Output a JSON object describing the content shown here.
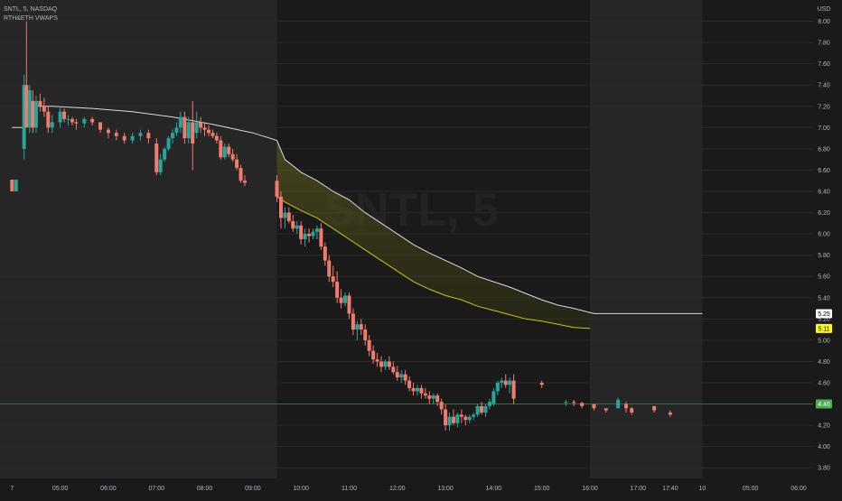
{
  "legend": {
    "symbol_line": "SNTL, 5, NASDAQ",
    "indicator_line": "RTH&ETH VWAPS"
  },
  "watermark": "SNTL, 5",
  "colors": {
    "background": "#1a1a1a",
    "extended_session_bg": "#262626",
    "up_candle": "#26a69a",
    "down_candle": "#ef7c6e",
    "eth_vwap": "#d9d9d9",
    "rth_vwap": "#c8c800",
    "current_price": "#4caf50",
    "rth_vwap_badge": "#ffff00"
  },
  "chart_data": {
    "type": "candlestick",
    "currency_label": "USD",
    "ylim": [
      3.7,
      8.2
    ],
    "y_ticks": [
      "8.00",
      "7.80",
      "7.60",
      "7.40",
      "7.20",
      "7.00",
      "6.80",
      "6.60",
      "6.40",
      "6.20",
      "6.00",
      "5.80",
      "5.60",
      "5.40",
      "5.20",
      "5.00",
      "4.80",
      "4.60",
      "4.40",
      "4.20",
      "4.00",
      "3.80"
    ],
    "x_ticks": [
      {
        "label": "7",
        "t": 0
      },
      {
        "label": "05:00",
        "t": 60
      },
      {
        "label": "06:00",
        "t": 120
      },
      {
        "label": "07:00",
        "t": 180
      },
      {
        "label": "08:00",
        "t": 240
      },
      {
        "label": "09:00",
        "t": 300
      },
      {
        "label": "10:00",
        "t": 360
      },
      {
        "label": "11:00",
        "t": 420
      },
      {
        "label": "12:00",
        "t": 480
      },
      {
        "label": "13:00",
        "t": 540
      },
      {
        "label": "14:00",
        "t": 600
      },
      {
        "label": "15:00",
        "t": 660
      },
      {
        "label": "16:00",
        "t": 720
      },
      {
        "label": "17:00",
        "t": 780
      },
      {
        "label": "17:40",
        "t": 820
      },
      {
        "label": "10",
        "t": 860
      },
      {
        "label": "05:00",
        "t": 920
      },
      {
        "label": "06:00",
        "t": 980
      }
    ],
    "regular_session": {
      "start": 330,
      "end": 720
    },
    "price_badges": [
      {
        "name": "eth_vwap",
        "value": "5.25"
      },
      {
        "name": "rth_vwap",
        "value": "5.11"
      },
      {
        "name": "last_price",
        "value": "4.40"
      }
    ],
    "candles": [
      [
        0,
        6.51,
        6.51,
        6.4,
        6.4
      ],
      [
        5,
        6.4,
        6.51,
        6.4,
        6.51
      ],
      [
        15,
        6.8,
        7.5,
        6.7,
        7.4
      ],
      [
        18,
        7.4,
        8.0,
        7.3,
        7.0
      ],
      [
        22,
        7.0,
        7.4,
        6.95,
        7.35
      ],
      [
        26,
        7.25,
        7.35,
        6.95,
        7.0
      ],
      [
        30,
        7.0,
        7.3,
        6.95,
        7.25
      ],
      [
        35,
        7.25,
        7.32,
        7.15,
        7.2
      ],
      [
        40,
        7.2,
        7.28,
        7.1,
        7.15
      ],
      [
        45,
        7.15,
        7.2,
        6.95,
        7.0
      ],
      [
        50,
        7.0,
        7.12,
        6.95,
        7.05
      ],
      [
        60,
        7.05,
        7.2,
        7.0,
        7.15
      ],
      [
        65,
        7.15,
        7.18,
        7.05,
        7.08
      ],
      [
        70,
        7.08,
        7.12,
        7.02,
        7.08
      ],
      [
        75,
        7.08,
        7.1,
        7.02,
        7.05
      ],
      [
        80,
        7.05,
        7.08,
        6.98,
        7.04
      ],
      [
        90,
        7.04,
        7.1,
        7.0,
        7.08
      ],
      [
        100,
        7.08,
        7.1,
        7.02,
        7.05
      ],
      [
        110,
        7.05,
        7.05,
        6.95,
        6.98
      ],
      [
        120,
        6.98,
        7.0,
        6.9,
        6.95
      ],
      [
        130,
        6.95,
        6.98,
        6.88,
        6.92
      ],
      [
        140,
        6.92,
        6.95,
        6.85,
        6.88
      ],
      [
        150,
        6.88,
        6.95,
        6.85,
        6.92
      ],
      [
        160,
        6.92,
        6.98,
        6.88,
        6.95
      ],
      [
        170,
        6.95,
        6.98,
        6.85,
        6.9
      ],
      [
        180,
        6.85,
        6.9,
        6.55,
        6.58
      ],
      [
        185,
        6.58,
        6.75,
        6.55,
        6.7
      ],
      [
        190,
        6.7,
        6.82,
        6.68,
        6.8
      ],
      [
        195,
        6.8,
        6.92,
        6.78,
        6.9
      ],
      [
        200,
        6.9,
        6.98,
        6.85,
        6.95
      ],
      [
        205,
        6.95,
        7.05,
        6.92,
        7.0
      ],
      [
        210,
        7.0,
        7.15,
        6.95,
        7.1
      ],
      [
        215,
        7.1,
        7.15,
        6.85,
        6.9
      ],
      [
        220,
        6.9,
        7.1,
        6.85,
        7.05
      ],
      [
        225,
        7.05,
        7.25,
        6.6,
        6.85
      ],
      [
        230,
        6.95,
        7.15,
        6.9,
        7.05
      ],
      [
        235,
        7.05,
        7.1,
        6.95,
        7.0
      ],
      [
        240,
        7.0,
        7.05,
        6.92,
        6.98
      ],
      [
        245,
        6.98,
        7.02,
        6.92,
        6.95
      ],
      [
        250,
        6.95,
        6.98,
        6.9,
        6.92
      ],
      [
        255,
        6.92,
        6.95,
        6.85,
        6.88
      ],
      [
        260,
        6.88,
        6.92,
        6.7,
        6.72
      ],
      [
        265,
        6.72,
        6.85,
        6.7,
        6.82
      ],
      [
        270,
        6.82,
        6.85,
        6.72,
        6.75
      ],
      [
        275,
        6.75,
        6.8,
        6.68,
        6.7
      ],
      [
        280,
        6.7,
        6.75,
        6.6,
        6.62
      ],
      [
        285,
        6.62,
        6.65,
        6.48,
        6.5
      ],
      [
        290,
        6.5,
        6.55,
        6.45,
        6.48
      ],
      [
        330,
        6.5,
        6.55,
        6.3,
        6.35
      ],
      [
        335,
        6.35,
        6.4,
        6.05,
        6.15
      ],
      [
        340,
        6.15,
        6.25,
        6.05,
        6.2
      ],
      [
        345,
        6.2,
        6.25,
        6.1,
        6.12
      ],
      [
        350,
        6.12,
        6.18,
        6.02,
        6.05
      ],
      [
        355,
        6.05,
        6.12,
        6.0,
        6.08
      ],
      [
        360,
        6.08,
        6.12,
        5.9,
        5.95
      ],
      [
        365,
        5.95,
        6.05,
        5.88,
        6.0
      ],
      [
        370,
        6.0,
        6.05,
        5.92,
        5.98
      ],
      [
        375,
        5.98,
        6.05,
        5.95,
        6.02
      ],
      [
        380,
        6.02,
        6.08,
        5.95,
        6.05
      ],
      [
        385,
        6.05,
        6.1,
        5.85,
        5.88
      ],
      [
        390,
        5.88,
        5.92,
        5.7,
        5.75
      ],
      [
        395,
        5.75,
        5.8,
        5.55,
        5.6
      ],
      [
        400,
        5.6,
        5.7,
        5.5,
        5.55
      ],
      [
        405,
        5.55,
        5.65,
        5.35,
        5.4
      ],
      [
        410,
        5.4,
        5.48,
        5.3,
        5.35
      ],
      [
        415,
        5.35,
        5.45,
        5.32,
        5.42
      ],
      [
        420,
        5.42,
        5.45,
        5.2,
        5.25
      ],
      [
        425,
        5.25,
        5.3,
        5.05,
        5.1
      ],
      [
        430,
        5.1,
        5.18,
        5.0,
        5.15
      ],
      [
        435,
        5.15,
        5.2,
        5.05,
        5.1
      ],
      [
        440,
        5.1,
        5.15,
        4.95,
        5.0
      ],
      [
        445,
        5.0,
        5.05,
        4.85,
        4.9
      ],
      [
        450,
        4.9,
        4.95,
        4.78,
        4.82
      ],
      [
        455,
        4.82,
        4.88,
        4.75,
        4.8
      ],
      [
        460,
        4.8,
        4.85,
        4.7,
        4.75
      ],
      [
        465,
        4.75,
        4.82,
        4.72,
        4.8
      ],
      [
        470,
        4.8,
        4.85,
        4.72,
        4.75
      ],
      [
        475,
        4.75,
        4.8,
        4.68,
        4.7
      ],
      [
        480,
        4.7,
        4.76,
        4.62,
        4.65
      ],
      [
        485,
        4.65,
        4.72,
        4.6,
        4.68
      ],
      [
        490,
        4.68,
        4.72,
        4.58,
        4.62
      ],
      [
        495,
        4.62,
        4.66,
        4.52,
        4.55
      ],
      [
        500,
        4.55,
        4.6,
        4.48,
        4.52
      ],
      [
        505,
        4.52,
        4.58,
        4.48,
        4.55
      ],
      [
        510,
        4.55,
        4.58,
        4.45,
        4.5
      ],
      [
        515,
        4.5,
        4.55,
        4.45,
        4.48
      ],
      [
        520,
        4.48,
        4.52,
        4.4,
        4.45
      ],
      [
        525,
        4.45,
        4.5,
        4.4,
        4.48
      ],
      [
        530,
        4.48,
        4.5,
        4.38,
        4.42
      ],
      [
        535,
        4.42,
        4.45,
        4.3,
        4.35
      ],
      [
        540,
        4.35,
        4.4,
        4.15,
        4.2
      ],
      [
        545,
        4.2,
        4.32,
        4.15,
        4.28
      ],
      [
        550,
        4.28,
        4.35,
        4.2,
        4.22
      ],
      [
        555,
        4.22,
        4.32,
        4.18,
        4.3
      ],
      [
        560,
        4.3,
        4.35,
        4.22,
        4.28
      ],
      [
        565,
        4.28,
        4.3,
        4.2,
        4.25
      ],
      [
        570,
        4.25,
        4.3,
        4.22,
        4.28
      ],
      [
        575,
        4.28,
        4.32,
        4.25,
        4.3
      ],
      [
        580,
        4.3,
        4.4,
        4.28,
        4.38
      ],
      [
        585,
        4.38,
        4.42,
        4.3,
        4.32
      ],
      [
        590,
        4.32,
        4.4,
        4.28,
        4.38
      ],
      [
        595,
        4.38,
        4.45,
        4.35,
        4.42
      ],
      [
        600,
        4.4,
        4.55,
        4.38,
        4.52
      ],
      [
        605,
        4.52,
        4.62,
        4.48,
        4.6
      ],
      [
        610,
        4.6,
        4.65,
        4.55,
        4.62
      ],
      [
        615,
        4.62,
        4.68,
        4.55,
        4.58
      ],
      [
        620,
        4.58,
        4.65,
        4.5,
        4.62
      ],
      [
        625,
        4.62,
        4.68,
        4.4,
        4.45
      ],
      [
        660,
        4.6,
        4.62,
        4.55,
        4.58
      ],
      [
        690,
        4.42,
        4.44,
        4.38,
        4.42
      ],
      [
        700,
        4.42,
        4.44,
        4.38,
        4.41
      ],
      [
        710,
        4.41,
        4.42,
        4.36,
        4.38
      ],
      [
        725,
        4.4,
        4.4,
        4.34,
        4.36
      ],
      [
        740,
        4.36,
        4.36,
        4.32,
        4.34
      ],
      [
        755,
        4.36,
        4.46,
        4.36,
        4.44
      ],
      [
        765,
        4.4,
        4.42,
        4.32,
        4.36
      ],
      [
        772,
        4.36,
        4.37,
        4.3,
        4.32
      ],
      [
        800,
        4.38,
        4.38,
        4.32,
        4.34
      ],
      [
        820,
        4.32,
        4.34,
        4.28,
        4.3
      ]
    ],
    "eth_vwap": [
      [
        0,
        7.0
      ],
      [
        15,
        7.0
      ],
      [
        18,
        7.2
      ],
      [
        50,
        7.2
      ],
      [
        100,
        7.18
      ],
      [
        150,
        7.15
      ],
      [
        200,
        7.1
      ],
      [
        250,
        7.03
      ],
      [
        300,
        6.95
      ],
      [
        330,
        6.88
      ],
      [
        340,
        6.7
      ],
      [
        360,
        6.58
      ],
      [
        380,
        6.5
      ],
      [
        400,
        6.4
      ],
      [
        420,
        6.32
      ],
      [
        440,
        6.2
      ],
      [
        460,
        6.1
      ],
      [
        480,
        6.0
      ],
      [
        500,
        5.9
      ],
      [
        520,
        5.82
      ],
      [
        540,
        5.75
      ],
      [
        560,
        5.68
      ],
      [
        580,
        5.6
      ],
      [
        600,
        5.55
      ],
      [
        620,
        5.5
      ],
      [
        640,
        5.44
      ],
      [
        660,
        5.38
      ],
      [
        680,
        5.33
      ],
      [
        700,
        5.3
      ],
      [
        715,
        5.27
      ],
      [
        725,
        5.25
      ],
      [
        860,
        5.25
      ]
    ],
    "rth_vwap": [
      [
        330,
        6.35
      ],
      [
        340,
        6.3
      ],
      [
        360,
        6.22
      ],
      [
        380,
        6.15
      ],
      [
        400,
        6.05
      ],
      [
        420,
        5.95
      ],
      [
        440,
        5.85
      ],
      [
        460,
        5.75
      ],
      [
        480,
        5.65
      ],
      [
        500,
        5.55
      ],
      [
        520,
        5.48
      ],
      [
        540,
        5.42
      ],
      [
        560,
        5.38
      ],
      [
        580,
        5.32
      ],
      [
        600,
        5.28
      ],
      [
        620,
        5.24
      ],
      [
        640,
        5.2
      ],
      [
        660,
        5.18
      ],
      [
        680,
        5.15
      ],
      [
        700,
        5.12
      ],
      [
        720,
        5.11
      ]
    ]
  }
}
